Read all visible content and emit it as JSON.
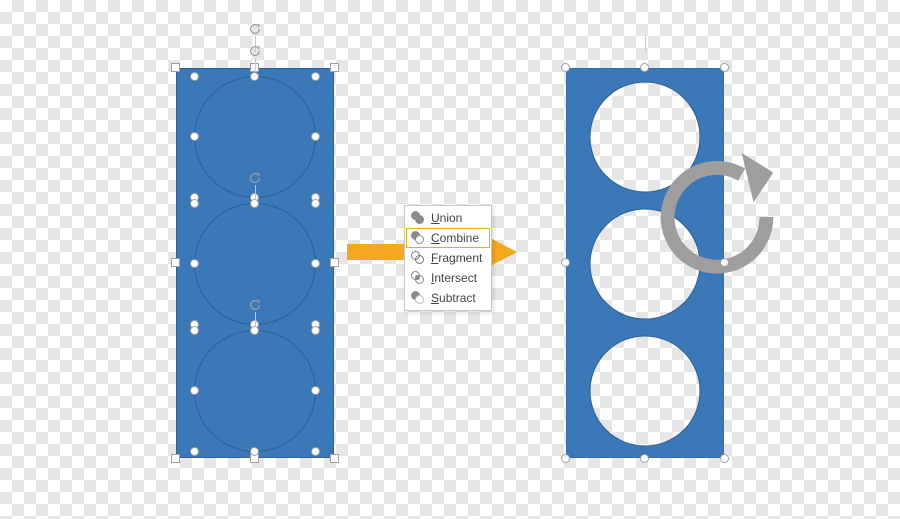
{
  "colors": {
    "shape_fill": "#3b78b8",
    "shape_stroke": "#2f5f95",
    "arrow": "#f3a81f",
    "menu_highlight": "#f3a81f"
  },
  "menu": {
    "items": [
      {
        "id": "union",
        "label": "Union"
      },
      {
        "id": "combine",
        "label": "Combine"
      },
      {
        "id": "fragment",
        "label": "Fragment"
      },
      {
        "id": "intersect",
        "label": "Intersect"
      },
      {
        "id": "subtract",
        "label": "Subtract"
      }
    ],
    "highlighted_id": "combine"
  }
}
